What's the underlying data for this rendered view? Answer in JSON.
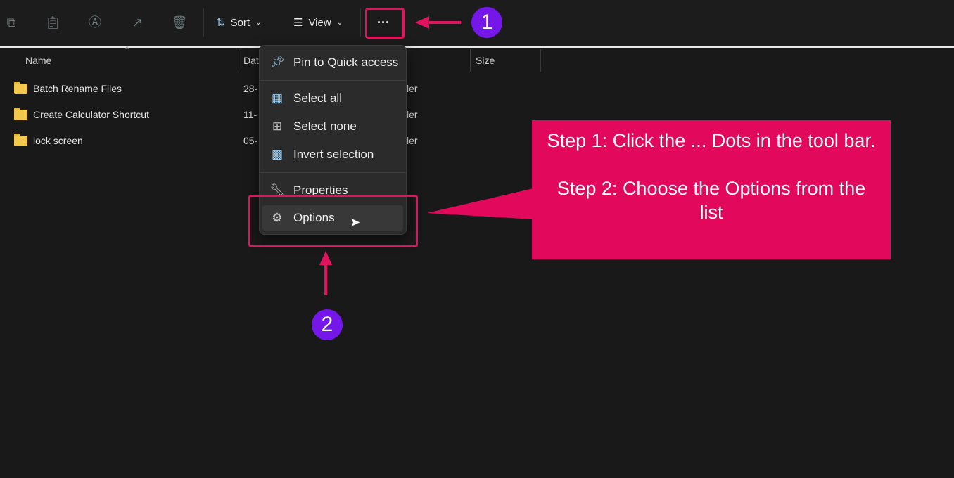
{
  "toolbar": {
    "sort_label": "Sort",
    "view_label": "View",
    "more_label": "···",
    "icons": [
      "copy-icon",
      "paste-icon",
      "rename-icon",
      "share-icon",
      "delete-icon"
    ]
  },
  "columns": {
    "name": "Name",
    "date": "Dat",
    "size": "Size"
  },
  "files": [
    {
      "name": "Batch Rename Files",
      "date": "28-",
      "type": "ler"
    },
    {
      "name": "Create Calculator Shortcut",
      "date": "11-",
      "type": "ler"
    },
    {
      "name": "lock screen",
      "date": "05-",
      "type": "ler"
    }
  ],
  "menu": {
    "items": [
      {
        "label": "Pin to Quick access",
        "icon": "pin-icon"
      },
      {
        "label": "Select all",
        "icon": "select-all-icon"
      },
      {
        "label": "Select none",
        "icon": "select-none-icon"
      },
      {
        "label": "Invert selection",
        "icon": "invert-selection-icon"
      },
      {
        "label": "Properties",
        "icon": "wrench-icon"
      },
      {
        "label": "Options",
        "icon": "gear-icon"
      }
    ]
  },
  "annotations": {
    "badge1": "1",
    "badge2": "2",
    "step1": "Step 1: Click the ... Dots in the tool bar.",
    "step2": "Step 2: Choose the Options from the list",
    "accent": "#e2095c",
    "badge_color": "#7417e8"
  }
}
